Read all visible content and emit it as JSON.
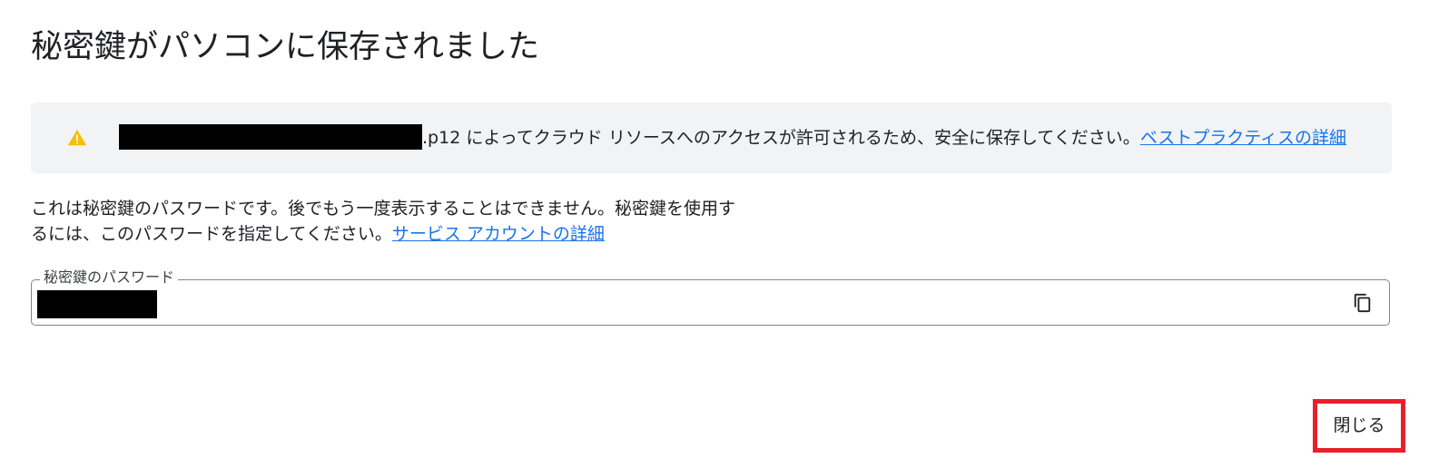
{
  "dialog": {
    "title": "秘密鍵がパソコンに保存されました"
  },
  "warning": {
    "icon": "warning-icon",
    "icon_color": "#fbbc04",
    "message": ".p12 によってクラウド リソースへのアクセスが許可されるため、安全に保存してください。",
    "link_label": "ベストプラクティスの詳細"
  },
  "description": {
    "text": "これは秘密鍵のパスワードです。後でもう一度表示することはできません。秘密鍵を使用するには、このパスワードを指定してください。",
    "link_label": "サービス アカウントの詳細"
  },
  "password_field": {
    "label": "秘密鍵のパスワード",
    "copy_icon": "copy-icon"
  },
  "actions": {
    "close_label": "閉じる",
    "highlight_color": "#e8202a"
  },
  "colors": {
    "link": "#1a73e8",
    "banner_background": "#f1f3f4"
  }
}
